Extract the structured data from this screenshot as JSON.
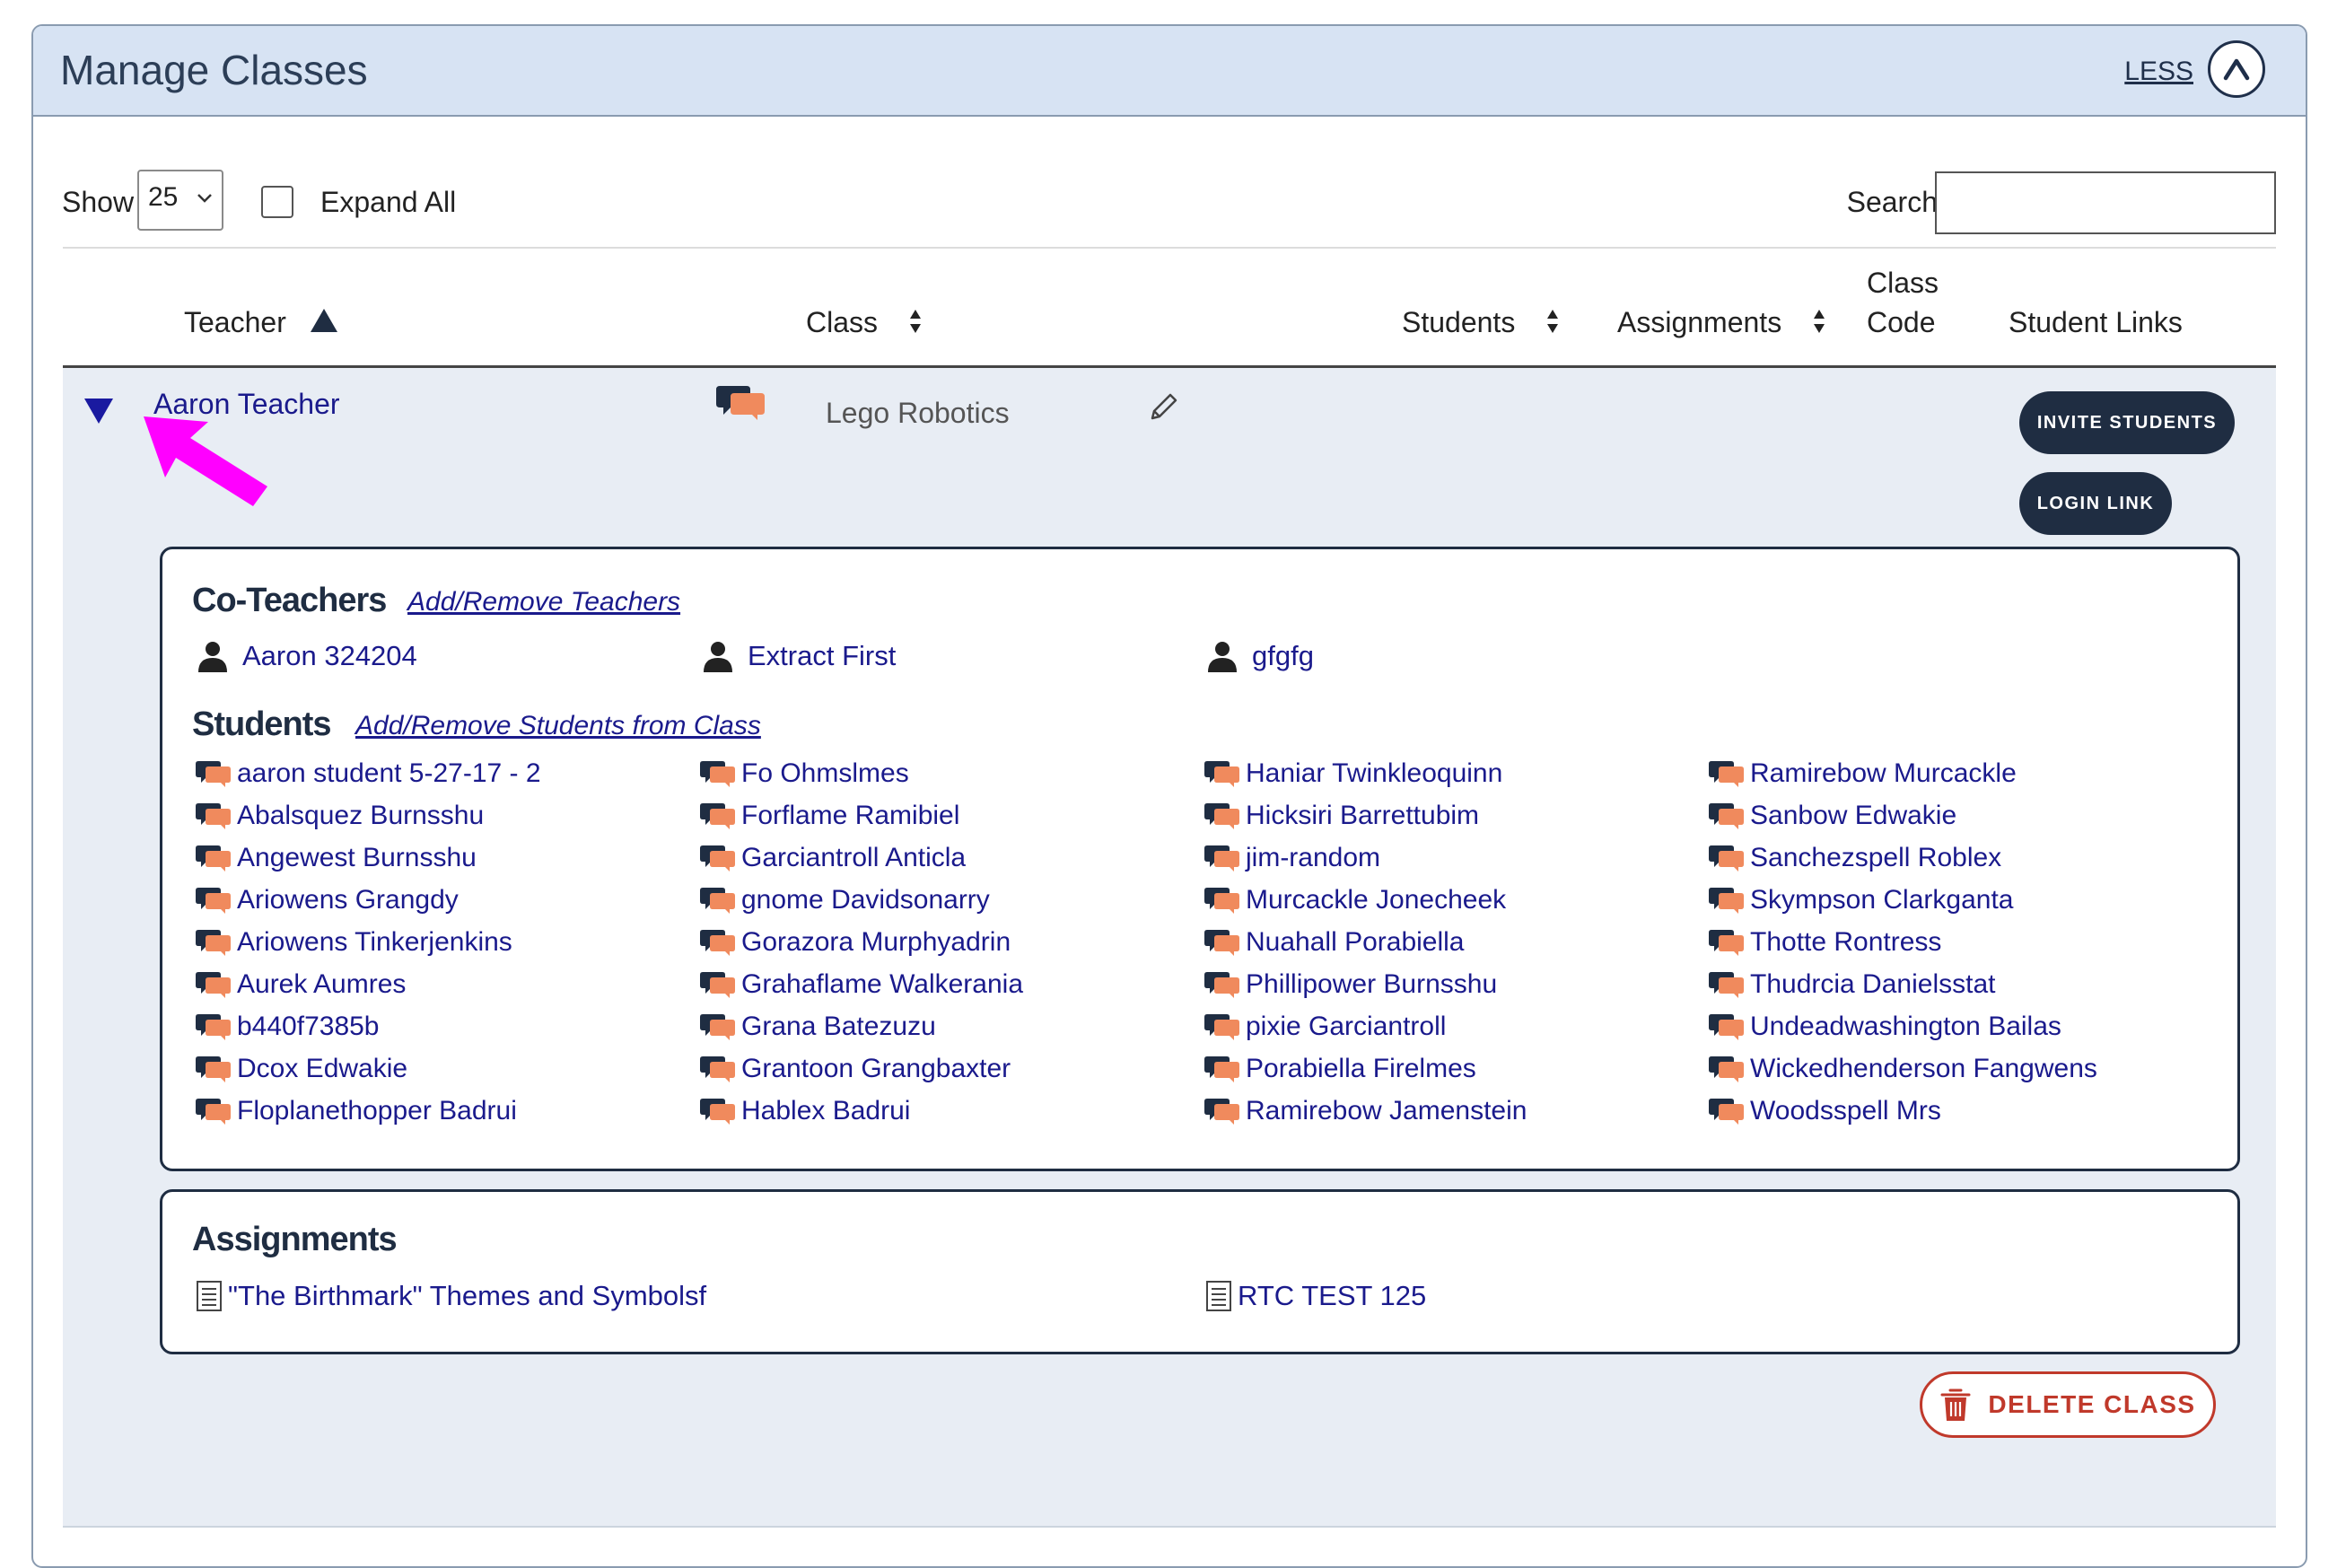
{
  "panel": {
    "title": "Manage Classes",
    "less_label": "LESS"
  },
  "controls": {
    "show_label": "Show",
    "show_value": "25",
    "expand_all_label": "Expand All",
    "search_label": "Search",
    "search_value": ""
  },
  "table": {
    "headers": {
      "teacher": "Teacher",
      "class": "Class",
      "students": "Students",
      "assignments": "Assignments",
      "class_code_line1": "Class",
      "class_code_line2": "Code",
      "student_links": "Student Links"
    },
    "row": {
      "teacher": "Aaron Teacher",
      "class_name": "Lego Robotics",
      "invite_button": "INVITE STUDENTS",
      "login_button": "LOGIN LINK"
    }
  },
  "co_teachers": {
    "title": "Co-Teachers",
    "link": "Add/Remove Teachers",
    "items": [
      "Aaron 324204",
      "Extract First",
      "gfgfg"
    ]
  },
  "students": {
    "title": "Students",
    "link": "Add/Remove Students from Class",
    "columns": [
      [
        "aaron student 5-27-17 - 2",
        "Abalsquez Burnsshu",
        "Angewest Burnsshu",
        "Ariowens Grangdy",
        "Ariowens Tinkerjenkins",
        "Aurek Aumres",
        "b440f7385b",
        "Dcox Edwakie",
        "Floplanethopper Badrui"
      ],
      [
        "Fo Ohmslmes",
        "Forflame Ramibiel",
        "Garciantroll Anticla",
        "gnome Davidsonarry",
        "Gorazora Murphyadrin",
        "Grahaflame Walkerania",
        "Grana Batezuzu",
        "Grantoon Grangbaxter",
        "Hablex Badrui"
      ],
      [
        "Haniar Twinkleoquinn",
        "Hicksiri Barrettubim",
        "jim-random",
        "Murcackle Jonecheek",
        "Nuahall Porabiella",
        "Phillipower Burnsshu",
        "pixie Garciantroll",
        "Porabiella Firelmes",
        "Ramirebow Jamenstein"
      ],
      [
        "Ramirebow Murcackle",
        "Sanbow Edwakie",
        "Sanchezspell Roblex",
        "Skympson Clarkganta",
        "Thotte Rontress",
        "Thudrcia Danielsstat",
        "Undeadwashington Bailas",
        "Wickedhenderson Fangwens",
        "Woodsspell Mrs"
      ]
    ]
  },
  "assignments": {
    "title": "Assignments",
    "items": [
      "\"The Birthmark\" Themes and Symbolsf",
      "RTC TEST 125"
    ]
  },
  "delete_button": "DELETE CLASS",
  "colors": {
    "navy": "#1f2d42",
    "link": "#1a1a8c",
    "header_bg": "#d7e3f3",
    "row_bg": "#e8edf4",
    "danger": "#c0392b",
    "annotation": "#ff00ff",
    "chat_orange": "#f08a5d"
  }
}
